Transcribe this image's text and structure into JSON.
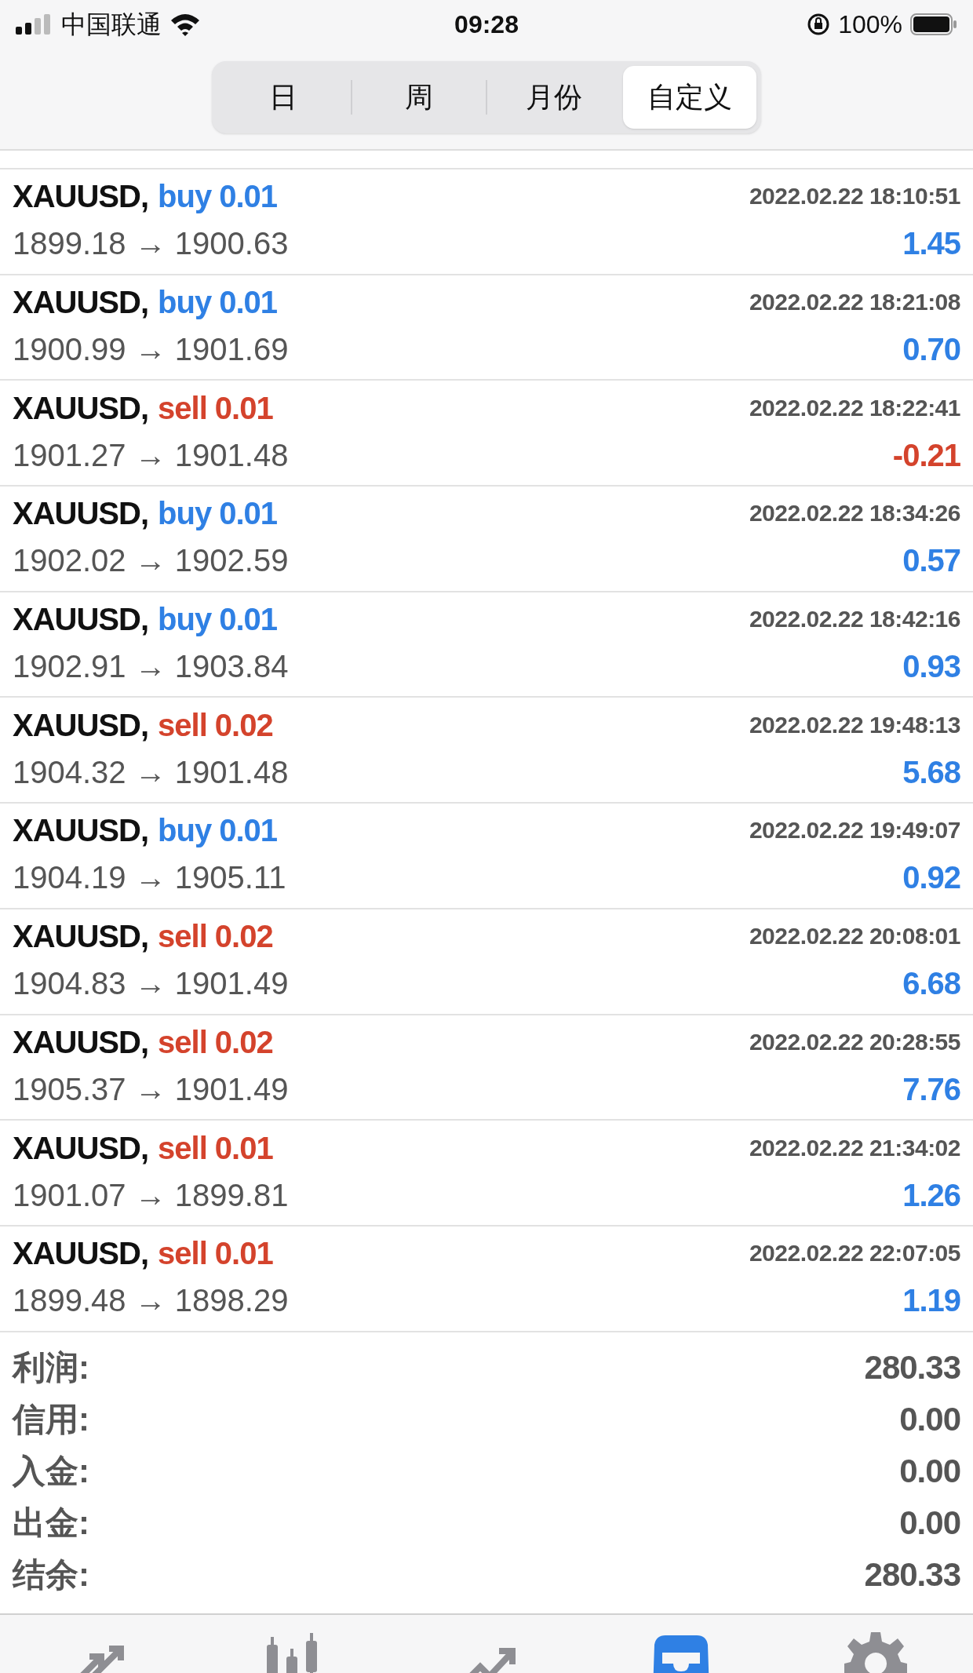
{
  "status_bar": {
    "carrier": "中国联通",
    "time": "09:28",
    "battery": "100%"
  },
  "period_tabs": [
    {
      "label": "日",
      "selected": false
    },
    {
      "label": "周",
      "selected": false
    },
    {
      "label": "月份",
      "selected": false
    },
    {
      "label": "自定义",
      "selected": true
    }
  ],
  "trades": [
    {
      "symbol": "XAUUSD,",
      "side": "buy",
      "volume": "0.01",
      "time": "2022.02.22 18:10:51",
      "prices": "1899.18 → 1900.63",
      "profit": "1.45",
      "loss": false
    },
    {
      "symbol": "XAUUSD,",
      "side": "buy",
      "volume": "0.01",
      "time": "2022.02.22 18:21:08",
      "prices": "1900.99 → 1901.69",
      "profit": "0.70",
      "loss": false
    },
    {
      "symbol": "XAUUSD,",
      "side": "sell",
      "volume": "0.01",
      "time": "2022.02.22 18:22:41",
      "prices": "1901.27 → 1901.48",
      "profit": "-0.21",
      "loss": true
    },
    {
      "symbol": "XAUUSD,",
      "side": "buy",
      "volume": "0.01",
      "time": "2022.02.22 18:34:26",
      "prices": "1902.02 → 1902.59",
      "profit": "0.57",
      "loss": false
    },
    {
      "symbol": "XAUUSD,",
      "side": "buy",
      "volume": "0.01",
      "time": "2022.02.22 18:42:16",
      "prices": "1902.91 → 1903.84",
      "profit": "0.93",
      "loss": false
    },
    {
      "symbol": "XAUUSD,",
      "side": "sell",
      "volume": "0.02",
      "time": "2022.02.22 19:48:13",
      "prices": "1904.32 → 1901.48",
      "profit": "5.68",
      "loss": false
    },
    {
      "symbol": "XAUUSD,",
      "side": "buy",
      "volume": "0.01",
      "time": "2022.02.22 19:49:07",
      "prices": "1904.19 → 1905.11",
      "profit": "0.92",
      "loss": false
    },
    {
      "symbol": "XAUUSD,",
      "side": "sell",
      "volume": "0.02",
      "time": "2022.02.22 20:08:01",
      "prices": "1904.83 → 1901.49",
      "profit": "6.68",
      "loss": false
    },
    {
      "symbol": "XAUUSD,",
      "side": "sell",
      "volume": "0.02",
      "time": "2022.02.22 20:28:55",
      "prices": "1905.37 → 1901.49",
      "profit": "7.76",
      "loss": false
    },
    {
      "symbol": "XAUUSD,",
      "side": "sell",
      "volume": "0.01",
      "time": "2022.02.22 21:34:02",
      "prices": "1901.07 → 1899.81",
      "profit": "1.26",
      "loss": false
    },
    {
      "symbol": "XAUUSD,",
      "side": "sell",
      "volume": "0.01",
      "time": "2022.02.22 22:07:05",
      "prices": "1899.48 → 1898.29",
      "profit": "1.19",
      "loss": false
    }
  ],
  "summary": [
    {
      "label": "利润:",
      "value": "280.33"
    },
    {
      "label": "信用:",
      "value": "0.00"
    },
    {
      "label": "入金:",
      "value": "0.00"
    },
    {
      "label": "出金:",
      "value": "0.00"
    },
    {
      "label": "结余:",
      "value": "280.33"
    }
  ],
  "bottom_tabs": [
    {
      "kind": "quotes",
      "selected": false
    },
    {
      "kind": "chart",
      "selected": false
    },
    {
      "kind": "trade",
      "selected": false
    },
    {
      "kind": "history",
      "selected": true
    },
    {
      "kind": "settings",
      "selected": false
    }
  ]
}
